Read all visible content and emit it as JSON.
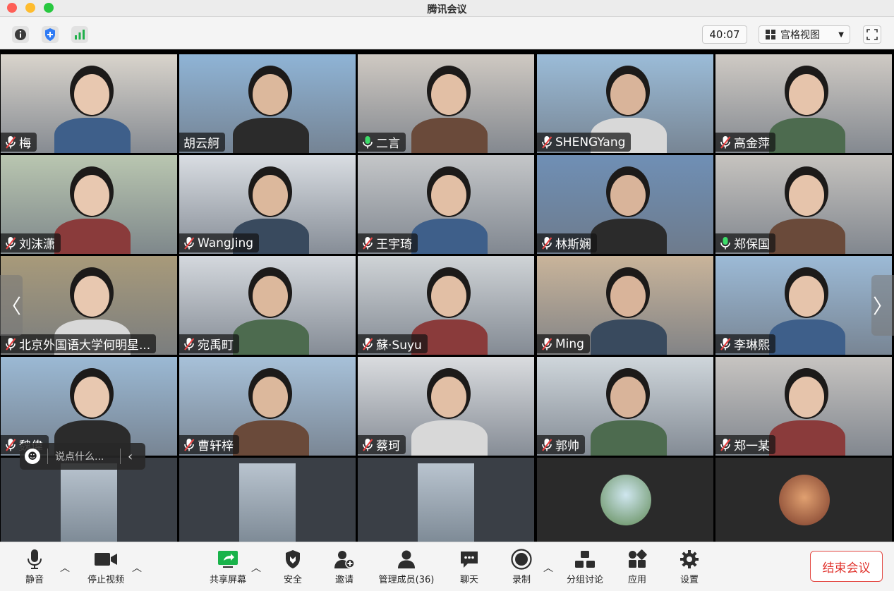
{
  "window": {
    "title": "腾讯会议"
  },
  "topbar": {
    "timer": "40:07",
    "view_label": "宫格视图",
    "icons": [
      "info-icon",
      "shield-icon",
      "signal-icon",
      "fullscreen-icon"
    ]
  },
  "participants": [
    {
      "name": "梅",
      "mic": "muted",
      "bg": "#d9d4cc"
    },
    {
      "name": "胡云舸",
      "mic": "none",
      "bg": "#8fb4d6"
    },
    {
      "name": "二言",
      "mic": "on",
      "bg": "#cfc9c2"
    },
    {
      "name": "SHENGYang",
      "mic": "muted",
      "bg": "#9bbcd8"
    },
    {
      "name": "高金萍",
      "mic": "muted",
      "bg": "#cfcac4"
    },
    {
      "name": "刘沫潇",
      "mic": "muted",
      "bg": "#b9c6b0"
    },
    {
      "name": "WangJing",
      "mic": "muted",
      "bg": "#d9dde2"
    },
    {
      "name": "王宇琦",
      "mic": "muted",
      "bg": "#c4c6c8"
    },
    {
      "name": "林斯娴",
      "mic": "muted",
      "bg": "#6f8fb5"
    },
    {
      "name": "郑保国",
      "mic": "on",
      "bg": "#c6c3bf"
    },
    {
      "name": "北京外国语大学何明星...",
      "mic": "muted",
      "bg": "#a89a7a"
    },
    {
      "name": "宛禹町",
      "mic": "muted",
      "bg": "#d4d8dd"
    },
    {
      "name": "蘇·Suyu",
      "mic": "muted",
      "bg": "#cfd3d6"
    },
    {
      "name": "Ming",
      "mic": "muted",
      "bg": "#c9b49a"
    },
    {
      "name": "李琳熙",
      "mic": "muted",
      "bg": "#9cbad6"
    },
    {
      "name": "魏偉",
      "mic": "muted",
      "bg": "#9bb9d4"
    },
    {
      "name": "曹轩梓",
      "mic": "muted",
      "bg": "#a7c1d9"
    },
    {
      "name": "蔡珂",
      "mic": "muted",
      "bg": "#dadcdf"
    },
    {
      "name": "郭帅",
      "mic": "muted",
      "bg": "#cfd6db"
    },
    {
      "name": "郑一某",
      "mic": "muted",
      "bg": "#c7c4c1"
    }
  ],
  "chat": {
    "placeholder": "说点什么..."
  },
  "toolbar": {
    "mute_label": "静音",
    "video_label": "停止视频",
    "share_label": "共享屏幕",
    "security_label": "安全",
    "invite_label": "邀请",
    "members_label": "管理成员(36)",
    "chat_label": "聊天",
    "record_label": "录制",
    "breakout_label": "分组讨论",
    "apps_label": "应用",
    "settings_label": "设置",
    "end_label": "结束会议"
  },
  "colors": {
    "accent_green": "#19b34a",
    "end_red": "#e0312b",
    "muted_red": "#e84545"
  }
}
